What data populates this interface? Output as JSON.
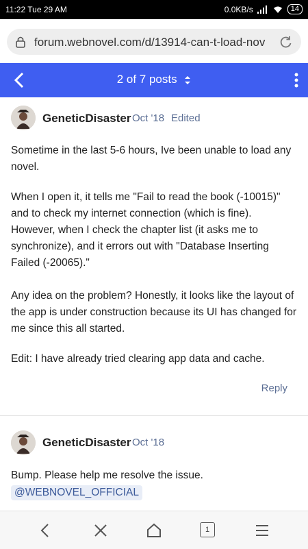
{
  "status": {
    "time": "11:22",
    "date": "Tue 29 AM",
    "speed": "0.0KB/s",
    "battery": "14"
  },
  "browser": {
    "url": "forum.webnovel.com/d/13914-can-t-load-nov"
  },
  "topnav": {
    "counter": "2 of 7 posts"
  },
  "posts": [
    {
      "author": "GeneticDisaster",
      "date": "Oct '18",
      "edited": "Edited",
      "paragraphs": [
        "Sometime in the last 5-6 hours, Ive been unable to load any novel.",
        "When I open it, it tells me \"Fail to read the book (-10015)\" and to check my internet connection (which is fine). However, when I check the chapter list (it asks me to synchronize), and it errors out with \"Database Inserting Failed (-20065).\"",
        "Any idea on the problem? Honestly, it looks like the layout of the app is under construction because its UI has changed for me since this all started.",
        "Edit: I have already tried clearing app data and cache."
      ],
      "reply_label": "Reply"
    },
    {
      "author": "GeneticDisaster",
      "date": "Oct '18",
      "paragraphs": [
        "Bump. Please help me resolve the issue."
      ],
      "mention": "@WEBNOVEL_OFFICIAL"
    }
  ],
  "bottombar": {
    "tab_count": "1"
  },
  "icons": [
    "lock-icon",
    "reload-icon",
    "back-arrow-icon",
    "sort-chevron-icon",
    "more-vert-icon",
    "signal-icon",
    "wifi-icon",
    "battery-icon",
    "nav-back-icon",
    "close-icon",
    "home-icon",
    "tabs-icon",
    "menu-icon"
  ],
  "colors": {
    "nav_bg": "#3f5ef1",
    "link": "#5b6e94",
    "mention_bg": "#e8edf7"
  }
}
